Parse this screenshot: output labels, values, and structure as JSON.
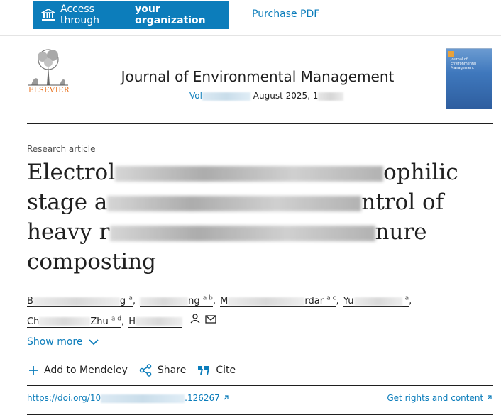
{
  "topbar": {
    "access_prefix": "Access through",
    "access_bold": "your organization",
    "purchase": "Purchase PDF"
  },
  "journal": {
    "publisher": "ELSEVIER",
    "title": "Journal of Environmental Management",
    "vol_prefix": "Vol",
    "date": "August 2025, 1",
    "cover_title": "Journal of Environmental Management"
  },
  "article": {
    "type": "Research article",
    "title_line1_a": "Electrol",
    "title_line1_b": "ophilic",
    "title_line2_a": "stage a",
    "title_line2_b": "ntrol of",
    "title_line3_a": "heavy r",
    "title_line3_b": "nure",
    "title_line4": "composting"
  },
  "authors": {
    "a1_start": "B",
    "a1_end": "g",
    "a1_sup": "a",
    "a2_end": "ng",
    "a2_sup": "a b",
    "a3_start": "M",
    "a3_end": "rdar",
    "a3_sup": "a c",
    "a4_start": "Yu",
    "a4_sup": "a",
    "a5_start": "Ch",
    "a5_end": "Zhu",
    "a5_sup": "a d",
    "a6_start": "H"
  },
  "controls": {
    "show_more": "Show more",
    "add_mendeley": "Add to Mendeley",
    "share": "Share",
    "cite": "Cite"
  },
  "footer": {
    "doi_prefix": "https://doi.org/10",
    "doi_suffix": ".126267",
    "rights": "Get rights and content"
  },
  "colors": {
    "accent": "#0c7dbb",
    "publisher_orange": "#e9711c",
    "text": "#1f1f1f"
  },
  "icons": [
    "bank-icon",
    "external-link-icon",
    "chevron-down-icon",
    "plus-icon",
    "share-icon",
    "quote-icon",
    "person-icon",
    "envelope-icon"
  ]
}
